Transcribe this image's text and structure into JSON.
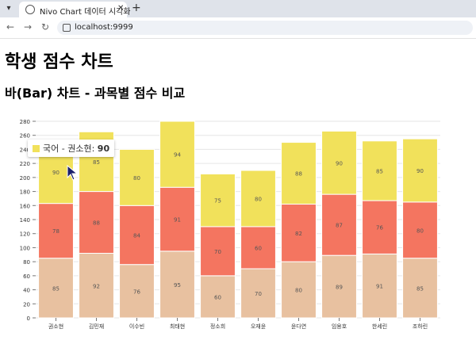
{
  "browser": {
    "tab_title": "Nivo Chart 데이터 시각화",
    "url": "localhost:9999",
    "new_tab_label": "+",
    "close_label": "✕"
  },
  "page": {
    "title": "학생 점수 차트",
    "subtitle": "바(Bar) 차트 - 과목별 점수 비교"
  },
  "tooltip": {
    "series": "국어",
    "separator": " - ",
    "student": "권소현",
    "value": "90",
    "color": "#f1e15b"
  },
  "chart_data": {
    "type": "bar",
    "stacked": true,
    "categories": [
      "권소현",
      "김민재",
      "이수빈",
      "최태현",
      "정소희",
      "오재윤",
      "윤다연",
      "임용호",
      "한세린",
      "조하린"
    ],
    "series": [
      {
        "key": "bottom",
        "color": "#e8c1a0",
        "values": [
          85,
          92,
          76,
          95,
          60,
          70,
          80,
          89,
          91,
          85
        ]
      },
      {
        "key": "middle",
        "color": "#f47560",
        "values": [
          78,
          88,
          84,
          91,
          70,
          60,
          82,
          87,
          76,
          80
        ]
      },
      {
        "key": "top",
        "color": "#f1e15b",
        "values": [
          90,
          85,
          80,
          94,
          75,
          80,
          88,
          90,
          85,
          90
        ]
      }
    ],
    "ylim": [
      0,
      280
    ],
    "yticks": [
      0,
      20,
      40,
      60,
      80,
      100,
      120,
      140,
      160,
      180,
      200,
      220,
      240,
      260,
      280
    ],
    "grid": true,
    "xlabel": "",
    "ylabel": ""
  }
}
